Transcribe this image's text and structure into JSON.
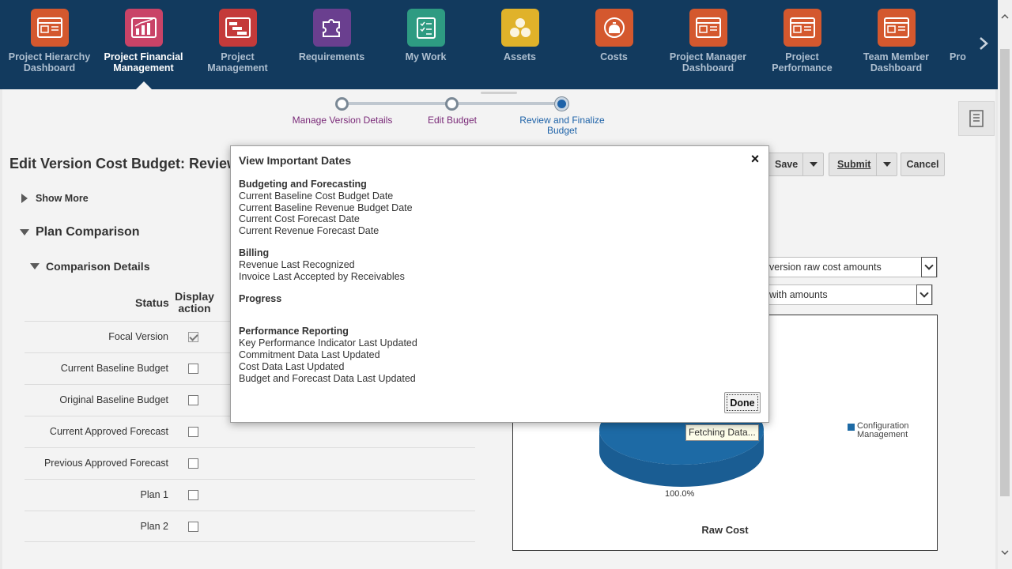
{
  "nav": {
    "items": [
      {
        "label": "Project Hierarchy Dashboard",
        "color": "#d4582e",
        "icon": "dashboard-icon"
      },
      {
        "label": "Project Financial Management",
        "color": "#c94367",
        "icon": "bar-chart-icon"
      },
      {
        "label": "Project Management",
        "color": "#c43a3a",
        "icon": "gantt-icon"
      },
      {
        "label": "Requirements",
        "color": "#6a3f8f",
        "icon": "puzzle-icon"
      },
      {
        "label": "My Work",
        "color": "#2e9b82",
        "icon": "checklist-icon"
      },
      {
        "label": "Assets",
        "color": "#e0b22a",
        "icon": "assets-icon"
      },
      {
        "label": "Costs",
        "color": "#d4582e",
        "icon": "piggy-bank-icon"
      },
      {
        "label": "Project Manager Dashboard",
        "color": "#d4582e",
        "icon": "dashboard-icon"
      },
      {
        "label": "Project Performance",
        "color": "#d4582e",
        "icon": "dashboard-icon"
      },
      {
        "label": "Team Member Dashboard",
        "color": "#d4582e",
        "icon": "dashboard-icon"
      },
      {
        "label": "Pro",
        "color": "#d4582e",
        "icon": "dashboard-icon"
      }
    ],
    "active_index": 1
  },
  "train": {
    "steps": [
      {
        "label": "Manage Version Details"
      },
      {
        "label": "Edit Budget"
      },
      {
        "label": "Review and Finalize Budget"
      }
    ],
    "current_index": 2
  },
  "page": {
    "title": "Edit Version Cost Budget: Review",
    "show_more": "Show More",
    "plan_comparison": "Plan Comparison",
    "comparison_details": "Comparison Details"
  },
  "buttons": {
    "save": "Save",
    "submit": "Submit",
    "cancel": "Cancel"
  },
  "table": {
    "headers": {
      "status": "Status",
      "display_action": "Display action"
    },
    "rows": [
      {
        "label": "Focal Version",
        "checked": true
      },
      {
        "label": "Current Baseline Budget",
        "checked": false
      },
      {
        "label": "Original Baseline Budget",
        "checked": false
      },
      {
        "label": "Current Approved Forecast",
        "checked": false
      },
      {
        "label": "Previous Approved Forecast",
        "checked": false
      },
      {
        "label": "Plan 1",
        "checked": false
      },
      {
        "label": "Plan 2",
        "checked": false
      }
    ]
  },
  "selects": {
    "amounts_1": "version raw cost amounts",
    "amounts_2": "with amounts"
  },
  "chart": {
    "legend": "Configuration Management",
    "percent_label": "100.0%",
    "title": "Raw Cost",
    "tooltip": "Fetching Data...",
    "color": "#1d6aa5"
  },
  "chart_data": {
    "type": "pie",
    "categories": [
      "Configuration Management"
    ],
    "values": [
      100.0
    ],
    "title": "Raw Cost"
  },
  "modal": {
    "title": "View Important Dates",
    "close": "×",
    "sections": [
      {
        "heading": "Budgeting and Forecasting",
        "items": [
          "Current Baseline Cost Budget Date",
          "Current Baseline Revenue Budget Date",
          "Current Cost Forecast Date",
          "Current Revenue Forecast Date"
        ]
      },
      {
        "heading": "Billing",
        "items": [
          "Revenue Last Recognized",
          "Invoice Last Accepted by Receivables"
        ]
      },
      {
        "heading": "Progress",
        "items": []
      },
      {
        "heading": "Performance Reporting",
        "items": [
          "Key Performance Indicator Last Updated",
          "Commitment Data Last Updated",
          "Cost Data Last Updated",
          "Budget and Forecast Data Last Updated"
        ]
      }
    ],
    "done": "Done"
  }
}
